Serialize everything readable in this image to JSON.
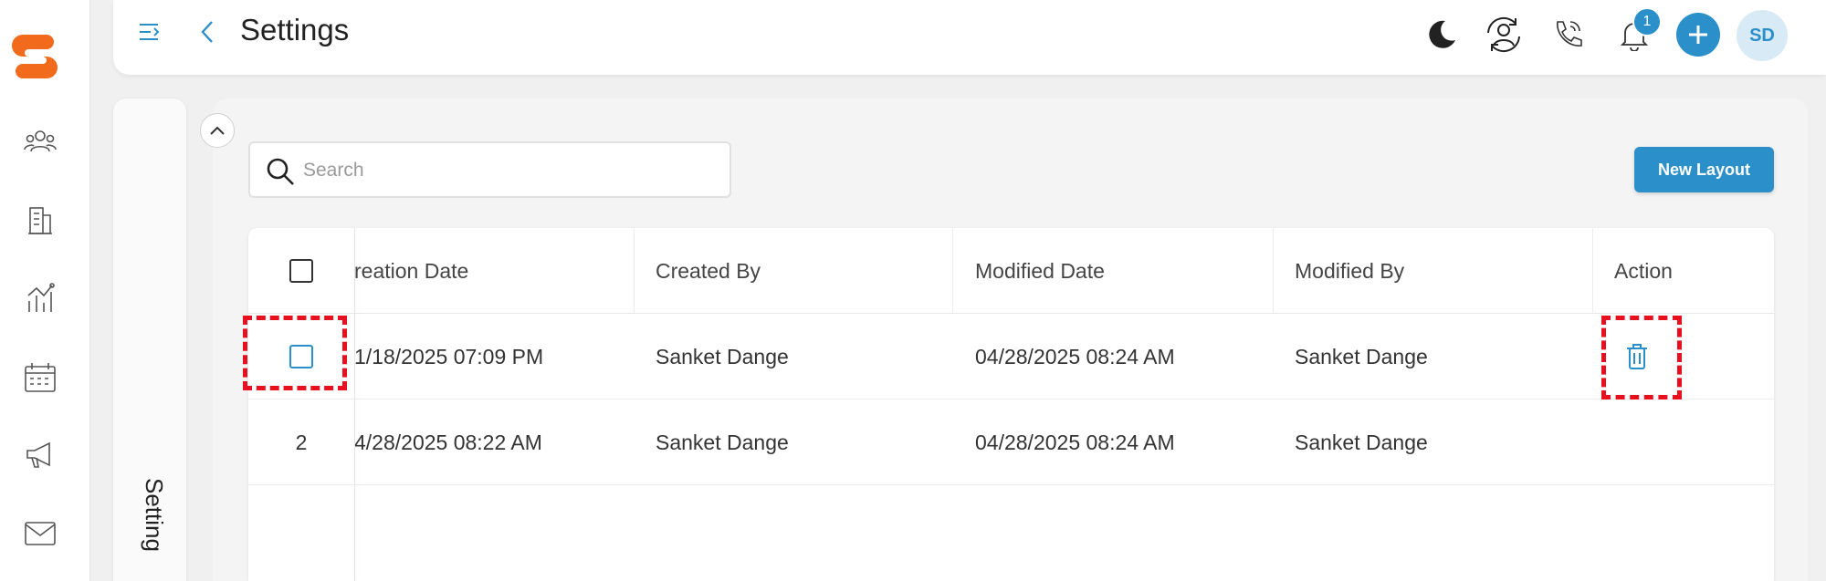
{
  "topbar": {
    "title": "Settings",
    "notification_count": "1",
    "avatar_initials": "SD"
  },
  "side_panel": {
    "vertical_label": "Setting"
  },
  "search": {
    "placeholder": "Search"
  },
  "toolbar": {
    "new_layout_label": "New Layout"
  },
  "table": {
    "columns": [
      "reation Date",
      "Created By",
      "Modified Date",
      "Modified By",
      "Action"
    ],
    "rows": [
      {
        "index": "",
        "creation_date": "1/18/2025 07:09 PM",
        "created_by": "Sanket Dange",
        "modified_date": "04/28/2025 08:24 AM",
        "modified_by": "Sanket Dange"
      },
      {
        "index": "2",
        "creation_date": "4/28/2025 08:22 AM",
        "created_by": "Sanket Dange",
        "modified_date": "04/28/2025 08:24 AM",
        "modified_by": "Sanket Dange"
      }
    ]
  },
  "colors": {
    "accent": "#2b8fc9",
    "logo": "#f26a1b",
    "highlight_dash": "#e8101e"
  },
  "icons": {
    "rail": [
      "users-icon",
      "building-icon",
      "analytics-icon",
      "calendar-icon",
      "megaphone-icon",
      "mail-icon"
    ],
    "topbar": [
      "dark-mode-icon",
      "user-sync-icon",
      "phone-icon",
      "bell-icon",
      "plus-icon"
    ]
  }
}
